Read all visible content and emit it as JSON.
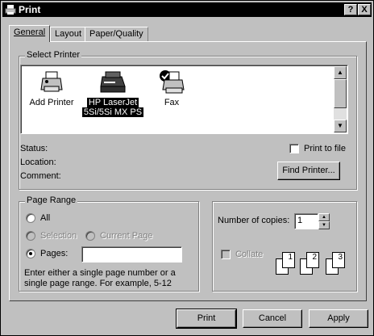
{
  "window": {
    "title": "Print",
    "help_label": "?",
    "close_label": "X"
  },
  "tabs": [
    {
      "label": "General"
    },
    {
      "label": "Layout"
    },
    {
      "label": "Paper/Quality"
    }
  ],
  "select_printer": {
    "group_label": "Select Printer",
    "printers": [
      {
        "line1": "Add Printer",
        "line2": ""
      },
      {
        "line1": "HP LaserJet",
        "line2": "5Si/5Si MX PS"
      },
      {
        "line1": "Fax",
        "line2": ""
      }
    ],
    "status_label": "Status:",
    "location_label": "Location:",
    "comment_label": "Comment:",
    "print_to_file_label": "Print to file",
    "find_printer_label": "Find Printer..."
  },
  "page_range": {
    "group_label": "Page Range",
    "all_label": "All",
    "selection_label": "Selection",
    "current_page_label": "Current Page",
    "pages_label": "Pages:",
    "pages_value": "",
    "hint_text": "Enter either a single page number or a single page range.  For example, 5-12",
    "selected": "pages"
  },
  "copies": {
    "number_label": "Number of copies:",
    "number_value": "1",
    "collate_label": "Collate",
    "pages": [
      "1",
      "1",
      "2",
      "2",
      "3",
      "3"
    ]
  },
  "buttons": {
    "print_label": "Print",
    "cancel_label": "Cancel",
    "apply_label": "Apply"
  }
}
